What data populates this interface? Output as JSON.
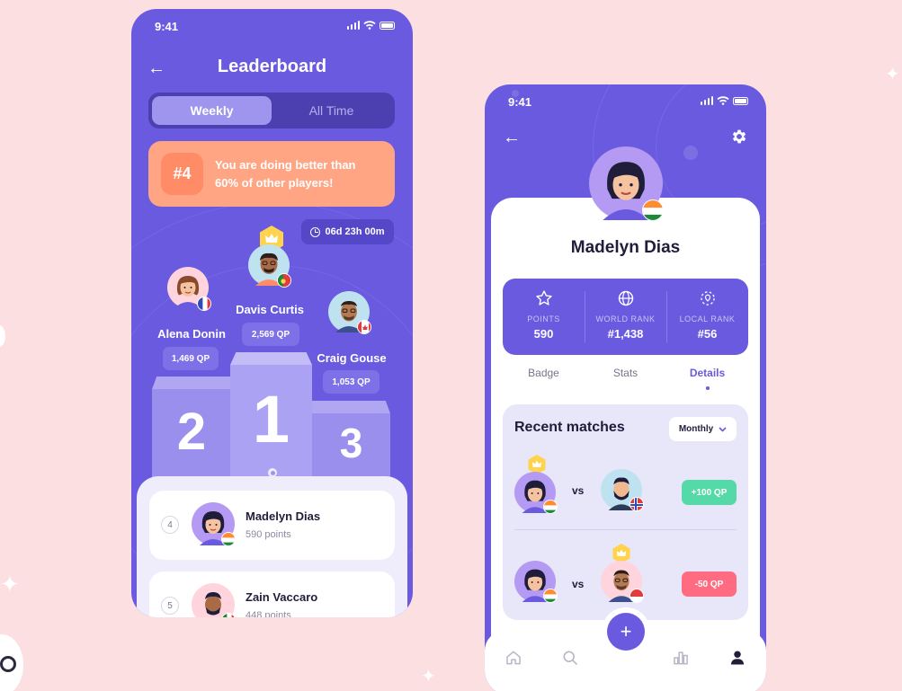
{
  "colors": {
    "primary": "#6a5ae0",
    "background": "#fbdfe1",
    "orange": "#ffa584",
    "gain": "#56d9a9",
    "loss": "#ff6b81",
    "gold": "#ffd34e"
  },
  "status_bar": {
    "time": "9:41"
  },
  "leaderboard": {
    "title": "Leaderboard",
    "tabs": [
      {
        "label": "Weekly",
        "active": true
      },
      {
        "label": "All Time",
        "active": false
      }
    ],
    "rank_card": {
      "rank": "#4",
      "message": "You are doing better than 60% of other players!"
    },
    "timer": "06d 23h 00m",
    "podium": [
      {
        "place": "2",
        "name": "Alena Donin",
        "points": "1,469 QP",
        "flag": "france"
      },
      {
        "place": "1",
        "name": "Davis Curtis",
        "points": "2,569 QP",
        "flag": "portugal"
      },
      {
        "place": "3",
        "name": "Craig Gouse",
        "points": "1,053 QP",
        "flag": "canada"
      }
    ],
    "list": [
      {
        "rank": "4",
        "name": "Madelyn Dias",
        "points": "590 points",
        "flag": "india"
      },
      {
        "rank": "5",
        "name": "Zain Vaccaro",
        "points": "448 points",
        "flag": "italy"
      }
    ]
  },
  "profile": {
    "name": "Madelyn Dias",
    "stats": [
      {
        "label": "POINTS",
        "value": "590",
        "icon": "star-icon"
      },
      {
        "label": "WORLD RANK",
        "value": "#1,438",
        "icon": "globe-icon"
      },
      {
        "label": "LOCAL RANK",
        "value": "#56",
        "icon": "location-icon"
      }
    ],
    "tabs": [
      {
        "label": "Badge",
        "active": false
      },
      {
        "label": "Stats",
        "active": false
      },
      {
        "label": "Details",
        "active": true
      }
    ],
    "recent_matches": {
      "title": "Recent matches",
      "filter": "Monthly",
      "matches": [
        {
          "opponent_flag": "norway",
          "result": "+100 QP",
          "winner": "player"
        },
        {
          "opponent_flag": "indonesia",
          "result": "-50 QP",
          "winner": "opponent"
        }
      ]
    },
    "nav": [
      "home-icon",
      "search-icon",
      "add-icon",
      "stats-icon",
      "profile-icon"
    ]
  }
}
